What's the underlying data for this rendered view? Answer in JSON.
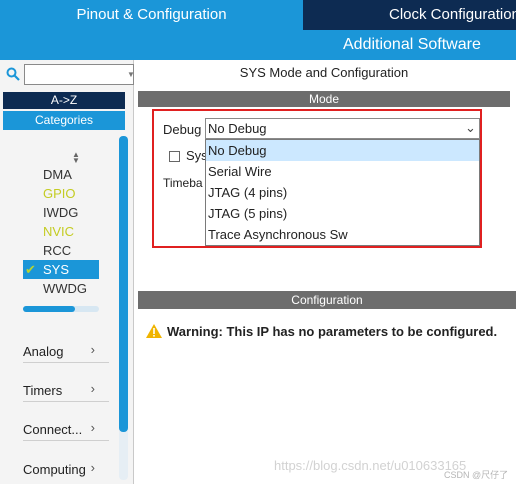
{
  "tabs": {
    "pinout": "Pinout & Configuration",
    "clock": "Clock Configuration",
    "additional": "Additional Software"
  },
  "sidebar": {
    "search_value": "",
    "sort_az": "A->Z",
    "categories_label": "Categories",
    "system_core_items": [
      {
        "label": "DMA",
        "color": "default",
        "selected": false,
        "checked": false
      },
      {
        "label": "GPIO",
        "color": "#c4cc22",
        "selected": false,
        "checked": false
      },
      {
        "label": "IWDG",
        "color": "default",
        "selected": false,
        "checked": false
      },
      {
        "label": "NVIC",
        "color": "#c4cc22",
        "selected": false,
        "checked": false
      },
      {
        "label": "RCC",
        "color": "default",
        "selected": false,
        "checked": false
      },
      {
        "label": "SYS",
        "color": "default",
        "selected": true,
        "checked": true
      },
      {
        "label": "WWDG",
        "color": "default",
        "selected": false,
        "checked": false
      }
    ],
    "categories": [
      {
        "label": "Analog"
      },
      {
        "label": "Timers"
      },
      {
        "label": "Connect..."
      },
      {
        "label": "Computing"
      }
    ]
  },
  "main": {
    "title": "SYS Mode and Configuration",
    "mode_header": "Mode",
    "debug_label": "Debug",
    "debug_value": "No Debug",
    "sys_checkbox_partial": "Sys",
    "timebase_partial": "Timeba",
    "debug_options": [
      "No Debug",
      "Serial Wire",
      "JTAG (4 pins)",
      "JTAG (5 pins)",
      "Trace Asynchronous Sw"
    ],
    "configuration_header": "Configuration",
    "warning_text": "Warning: This IP has no parameters to be configured."
  },
  "watermark": {
    "url": "https://blog.csdn.net/u010633165",
    "csdn": "CSDN @尺仔了"
  },
  "colors": {
    "accent_blue": "#1b96d8",
    "dark_navy": "#0d2b52",
    "highlight_red": "#e02020",
    "gray_header": "#6d6d6d"
  }
}
